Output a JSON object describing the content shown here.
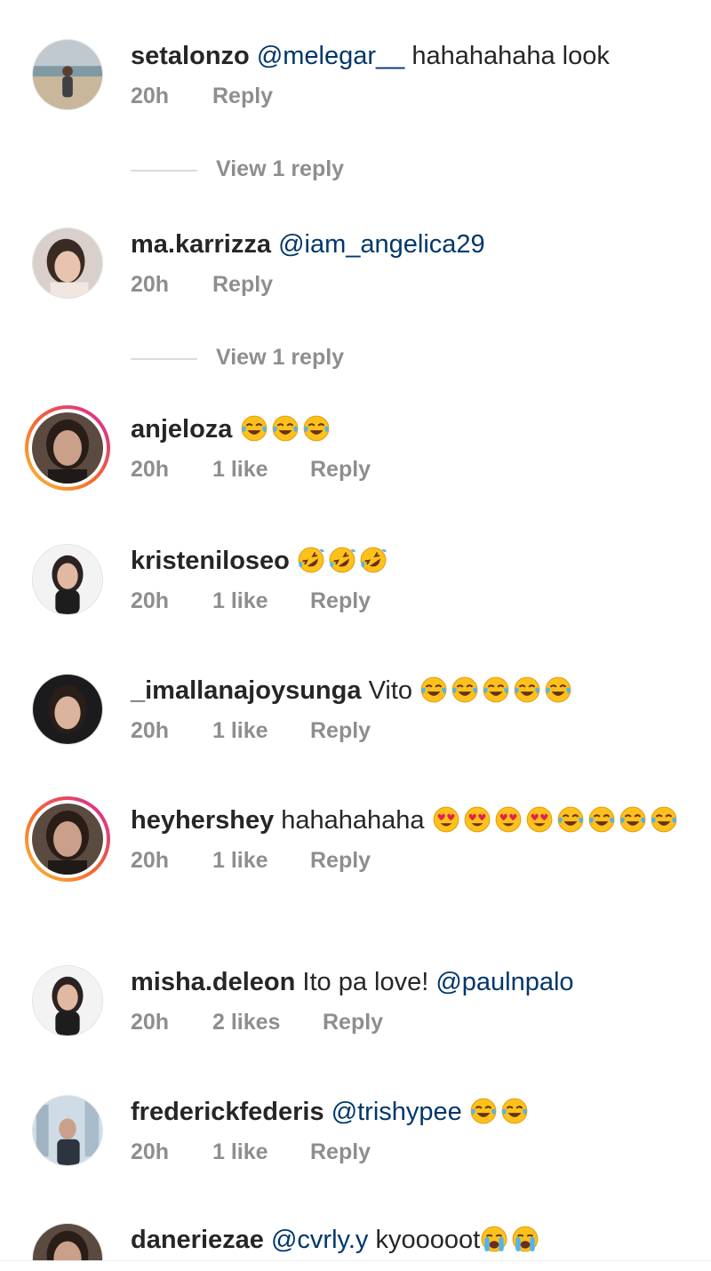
{
  "comments": [
    {
      "username": "setalonzo",
      "mention": "@melegar__",
      "text": " hahahahaha look",
      "emoji": [],
      "time": "20h",
      "likes": "",
      "reply": "Reply",
      "view_replies": "View 1 reply",
      "avatar": "beach-photo"
    },
    {
      "username": "ma.karrizza",
      "mention": "@iam_angelica29",
      "text": "",
      "emoji": [],
      "time": "20h",
      "likes": "",
      "reply": "Reply",
      "view_replies": "View 1 reply",
      "avatar": "selfie-photo"
    },
    {
      "username": "anjeloza",
      "mention": "",
      "text": "",
      "emoji": [
        "face-with-tears-of-joy",
        "face-with-tears-of-joy",
        "face-with-tears-of-joy"
      ],
      "time": "20h",
      "likes": "1 like",
      "reply": "Reply",
      "view_replies": "",
      "avatar": "portrait-photo",
      "story": true
    },
    {
      "username": "kristeniloseo",
      "mention": "",
      "text": "",
      "emoji": [
        "rolling-on-floor-laughing",
        "rolling-on-floor-laughing",
        "rolling-on-floor-laughing"
      ],
      "time": "20h",
      "likes": "1 like",
      "reply": "Reply",
      "view_replies": "",
      "avatar": "portrait-photo-light"
    },
    {
      "username": "_imallanajoysunga",
      "mention": "",
      "text": " Vito ",
      "emoji": [
        "face-with-tears-of-joy",
        "face-with-tears-of-joy",
        "face-with-tears-of-joy",
        "face-with-tears-of-joy",
        "face-with-tears-of-joy"
      ],
      "time": "20h",
      "likes": "1 like",
      "reply": "Reply",
      "view_replies": "",
      "avatar": "portrait-photo-dark"
    },
    {
      "username": "heyhershey",
      "mention": "",
      "text": " hahahahaha ",
      "emoji": [
        "heart-eyes",
        "heart-eyes",
        "heart-eyes",
        "heart-eyes",
        "face-with-tears-of-joy",
        "face-with-tears-of-joy",
        "face-with-tears-of-joy",
        "face-with-tears-of-joy"
      ],
      "time": "20h",
      "likes": "1 like",
      "reply": "Reply",
      "view_replies": "",
      "avatar": "portrait-photo",
      "story": true
    },
    {
      "username": "misha.deleon",
      "mention": "@paulnpalo",
      "text": " Ito pa love! ",
      "mention_after": true,
      "emoji": [],
      "time": "20h",
      "likes": "2 likes",
      "reply": "Reply",
      "view_replies": "",
      "avatar": "portrait-photo-light"
    },
    {
      "username": "frederickfederis",
      "mention": "@trishypee",
      "text": " ",
      "emoji": [
        "face-with-tears-of-joy",
        "face-with-tears-of-joy"
      ],
      "time": "20h",
      "likes": "1 like",
      "reply": "Reply",
      "view_replies": "",
      "avatar": "city-photo"
    },
    {
      "username": "daneriezae",
      "mention": "@cvrly.y",
      "text": " kyooooot",
      "emoji": [
        "loudly-crying-face",
        "loudly-crying-face"
      ],
      "time": "",
      "likes": "",
      "reply": "",
      "view_replies": "",
      "avatar": "portrait-photo"
    }
  ],
  "colors": {
    "text": "#262626",
    "meta": "#8e8e8e",
    "mention": "#00376b",
    "story_ring_start": "#f9c23c",
    "story_ring_end": "#d6249f"
  }
}
